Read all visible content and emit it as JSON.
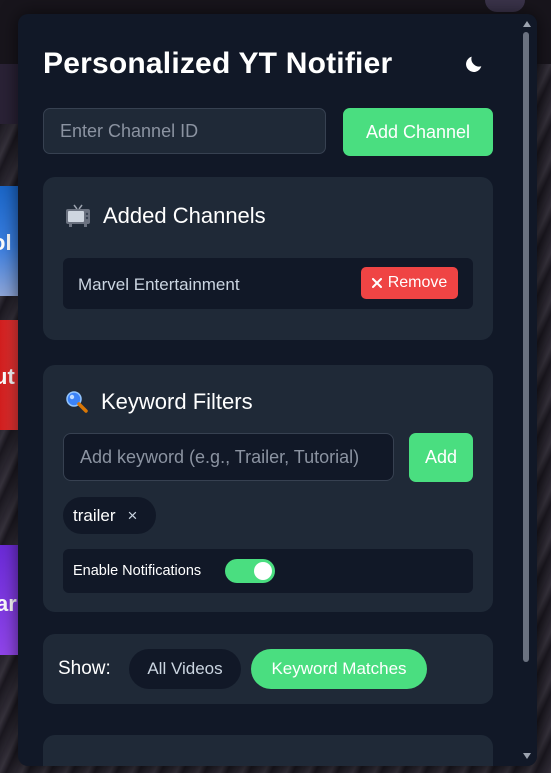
{
  "header": {
    "title": "Personalized YT Notifier",
    "theme_icon": "moon-icon"
  },
  "add_channel": {
    "placeholder": "Enter Channel ID",
    "value": "",
    "button_label": "Add Channel"
  },
  "channels": {
    "icon": "tv-icon",
    "title": "Added Channels",
    "items": [
      {
        "name": "Marvel Entertainment",
        "remove_label": "Remove",
        "remove_icon": "close-icon"
      }
    ]
  },
  "keywords": {
    "icon": "magnifier-icon",
    "title": "Keyword Filters",
    "input_placeholder": "Add keyword (e.g., Trailer, Tutorial)",
    "input_value": "",
    "add_label": "Add",
    "tags": [
      {
        "label": "trailer",
        "remove_glyph": "×"
      }
    ],
    "notifications_label": "Enable Notifications",
    "notifications_enabled": true
  },
  "show_filter": {
    "label": "Show:",
    "options": [
      "All Videos",
      "Keyword Matches"
    ],
    "selected": "Keyword Matches"
  },
  "background_page": {
    "thumbnail_fragments": [
      "ol",
      "ut",
      "ar"
    ]
  },
  "colors": {
    "accent": "#4ade80",
    "danger": "#ef4444",
    "panel_bg": "#111827",
    "card_bg": "#1f2937"
  }
}
